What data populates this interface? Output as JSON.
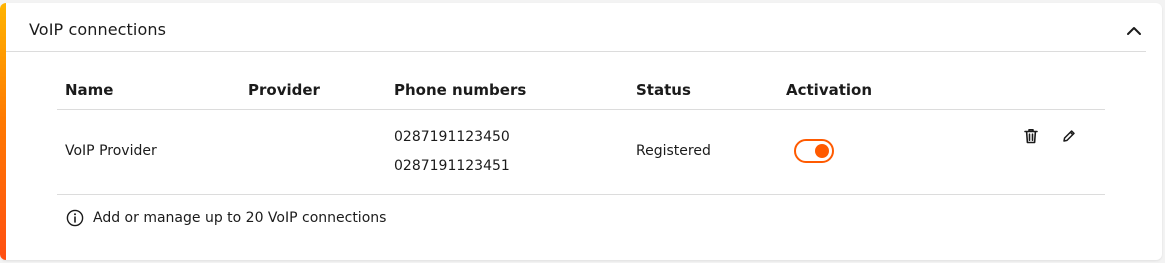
{
  "section": {
    "title": "VoIP connections",
    "accent_gradient": [
      "#ffb400",
      "#ff7a00",
      "#ff4f12"
    ],
    "collapse_icon": "chevron-up-icon"
  },
  "table": {
    "headers": {
      "name": "Name",
      "provider": "Provider",
      "phone_numbers": "Phone numbers",
      "status": "Status",
      "activation": "Activation"
    },
    "rows": [
      {
        "name": "VoIP Provider",
        "provider": "",
        "phone_numbers": [
          "0287191123450",
          "0287191123451"
        ],
        "status": "Registered",
        "activation_on": true,
        "actions": [
          "trash-icon",
          "pencil-icon"
        ]
      }
    ]
  },
  "info": {
    "icon": "info-icon",
    "text": "Add or manage up to 20 VoIP connections"
  },
  "colors": {
    "toggle_on": "#ff5a00",
    "divider": "#dcdcdc"
  }
}
